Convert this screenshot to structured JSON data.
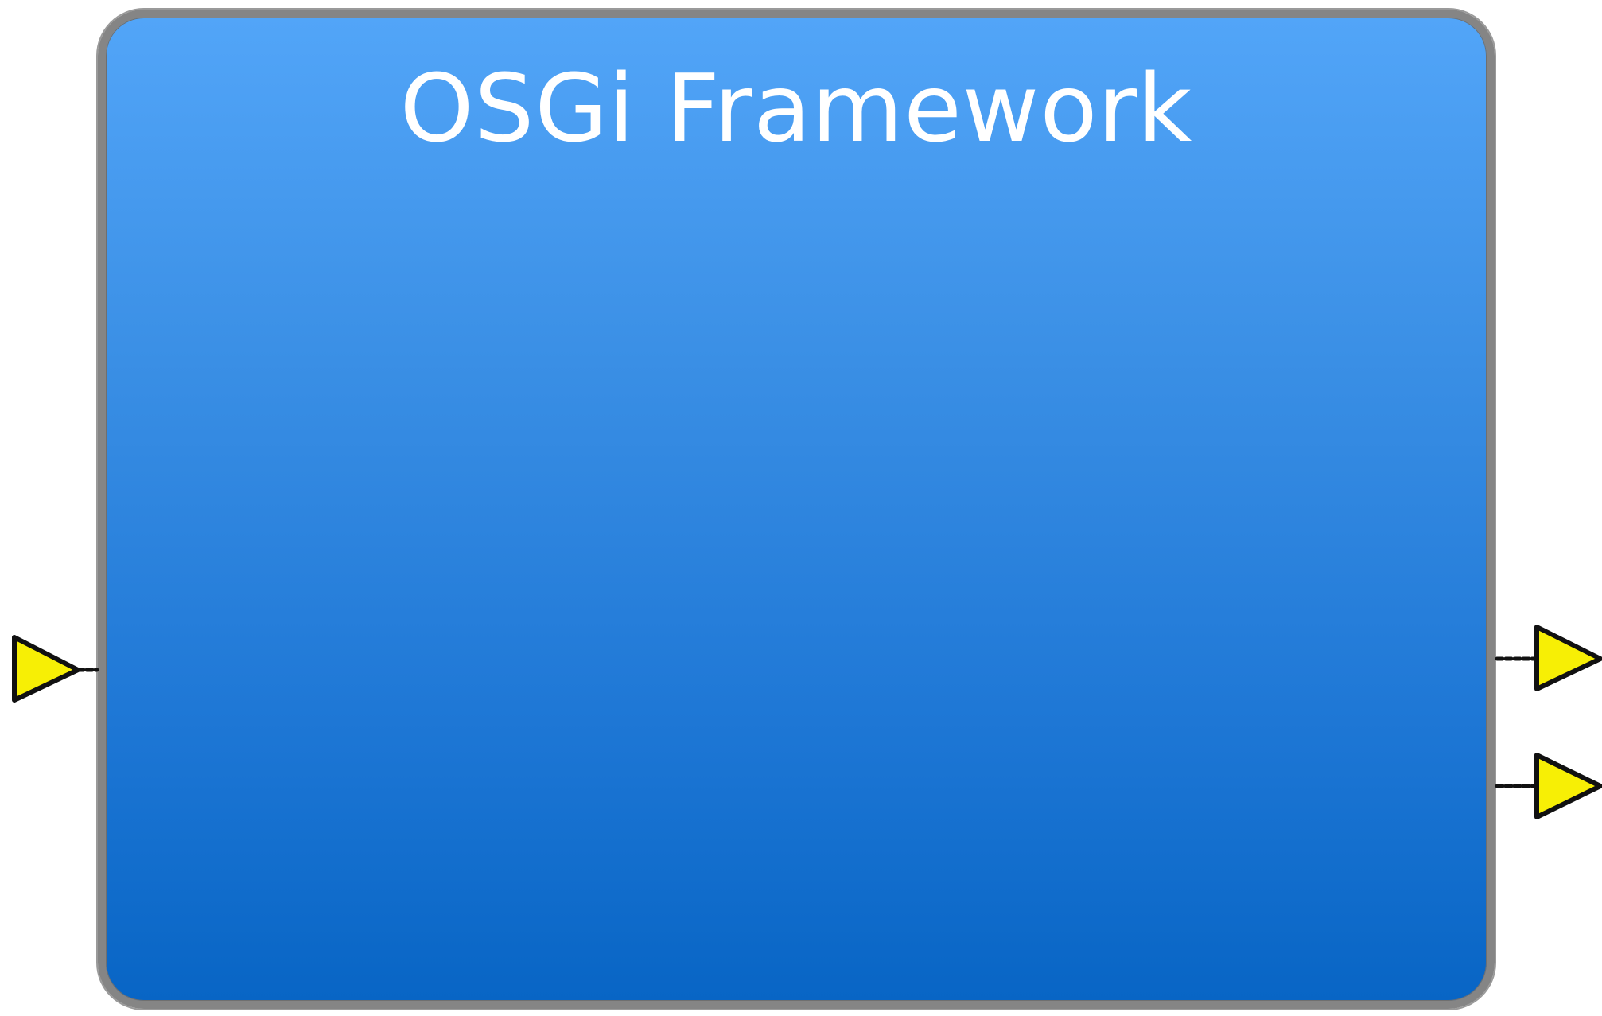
{
  "diagram": {
    "title": "OSGi Framework",
    "box_fill_top": "#52a5f8",
    "box_fill_bottom": "#0865c5",
    "box_border": "#858585",
    "connector_fill": "#f7ef05",
    "connector_stroke": "#111111",
    "ports": [
      {
        "name": "input-port",
        "side": "left"
      },
      {
        "name": "output-port-1",
        "side": "right"
      },
      {
        "name": "output-port-2",
        "side": "right"
      }
    ]
  }
}
